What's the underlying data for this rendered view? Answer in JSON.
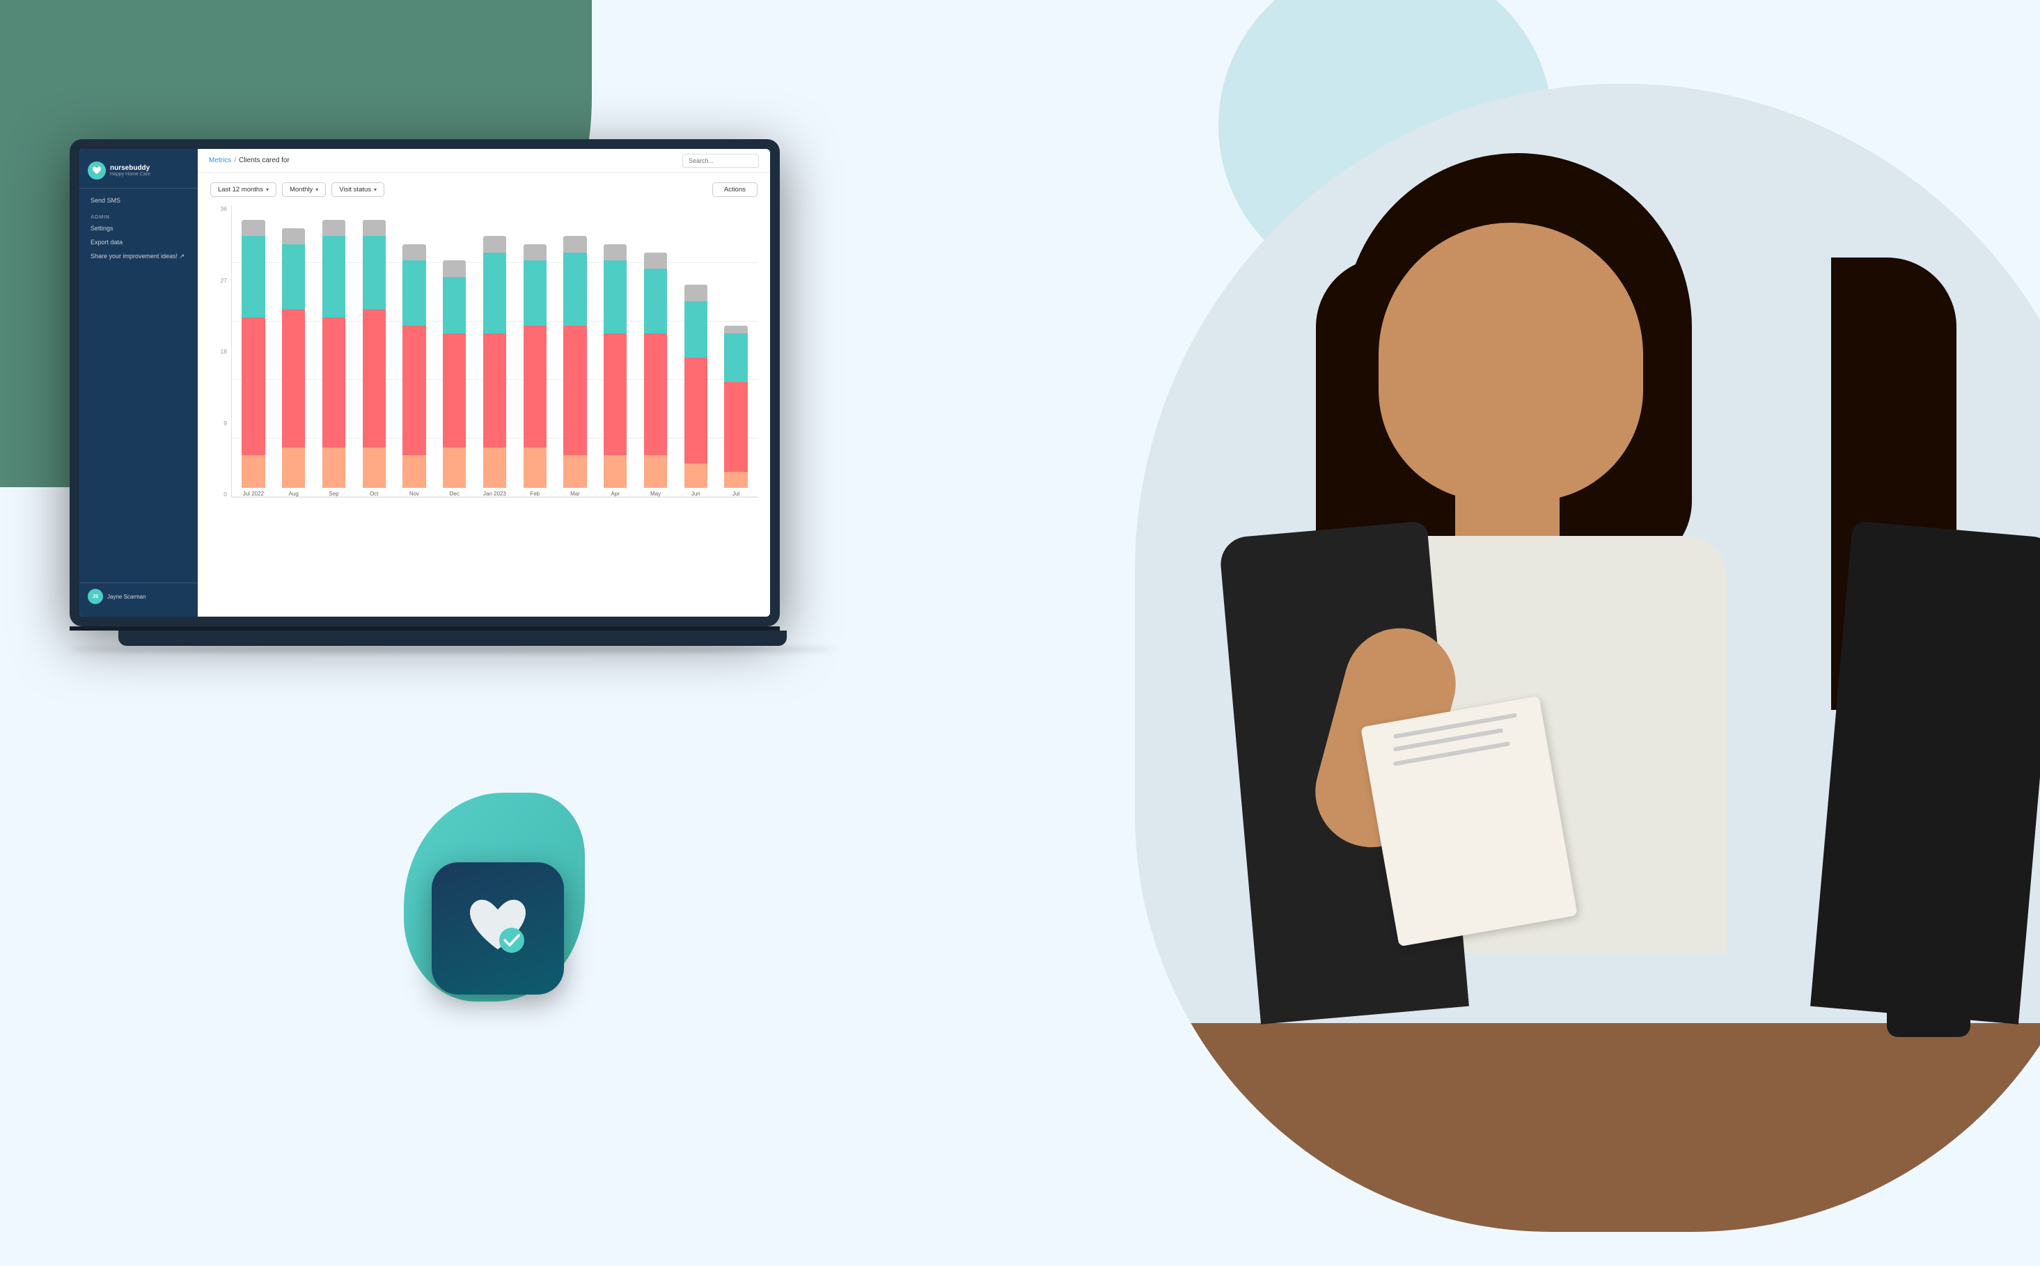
{
  "app": {
    "name": "nursebuddy",
    "tagline": "Happy Home Care"
  },
  "breadcrumb": {
    "parent": "Metrics",
    "separator": "/",
    "current": "Clients cared for"
  },
  "search": {
    "placeholder": "Search..."
  },
  "controls": {
    "period_label": "Last 12 months",
    "period_arrow": "▾",
    "frequency_label": "Monthly",
    "frequency_arrow": "▾",
    "filter_label": "Visit status",
    "filter_arrow": "▾",
    "actions_label": "Actions"
  },
  "chart": {
    "y_labels": [
      "0",
      "9",
      "18",
      "27",
      "36"
    ],
    "months": [
      {
        "label": "Jul 2022",
        "gray": 2,
        "teal": 10,
        "salmon": 17,
        "orange": 4
      },
      {
        "label": "Aug",
        "gray": 2,
        "teal": 8,
        "salmon": 17,
        "orange": 5
      },
      {
        "label": "Sep",
        "gray": 2,
        "teal": 10,
        "salmon": 16,
        "orange": 5
      },
      {
        "label": "Oct",
        "gray": 2,
        "teal": 9,
        "salmon": 17,
        "orange": 5
      },
      {
        "label": "Nov",
        "gray": 2,
        "teal": 8,
        "salmon": 16,
        "orange": 4
      },
      {
        "label": "Dec",
        "gray": 2,
        "teal": 7,
        "salmon": 14,
        "orange": 5
      },
      {
        "label": "Jan 2023",
        "gray": 2,
        "teal": 10,
        "salmon": 14,
        "orange": 5
      },
      {
        "label": "Feb",
        "gray": 2,
        "teal": 8,
        "salmon": 15,
        "orange": 5
      },
      {
        "label": "Mar",
        "gray": 2,
        "teal": 9,
        "salmon": 16,
        "orange": 4
      },
      {
        "label": "Apr",
        "gray": 2,
        "teal": 9,
        "salmon": 15,
        "orange": 4
      },
      {
        "label": "May",
        "gray": 2,
        "teal": 8,
        "salmon": 15,
        "orange": 4
      },
      {
        "label": "Jun",
        "gray": 2,
        "teal": 7,
        "salmon": 13,
        "orange": 3
      },
      {
        "label": "Jul",
        "gray": 1,
        "teal": 6,
        "salmon": 11,
        "orange": 2
      }
    ]
  },
  "sidebar": {
    "sections": [
      {
        "label": "",
        "items": [
          "Send SMS"
        ]
      },
      {
        "label": "Admin",
        "items": [
          "Settings",
          "Export data",
          "Share your improvement ideas! ↗"
        ]
      }
    ],
    "user": {
      "name": "Jayne Scarman",
      "initials": "JS"
    }
  },
  "colors": {
    "sidebar_bg": "#1a3a5c",
    "teal": "#4ecdc4",
    "salmon": "#ff6b6b",
    "orange": "#ffaa80",
    "gray_bar": "#cccccc",
    "badge_bg": "#1a3a5c",
    "teal_blob": "#4ecdc4"
  }
}
